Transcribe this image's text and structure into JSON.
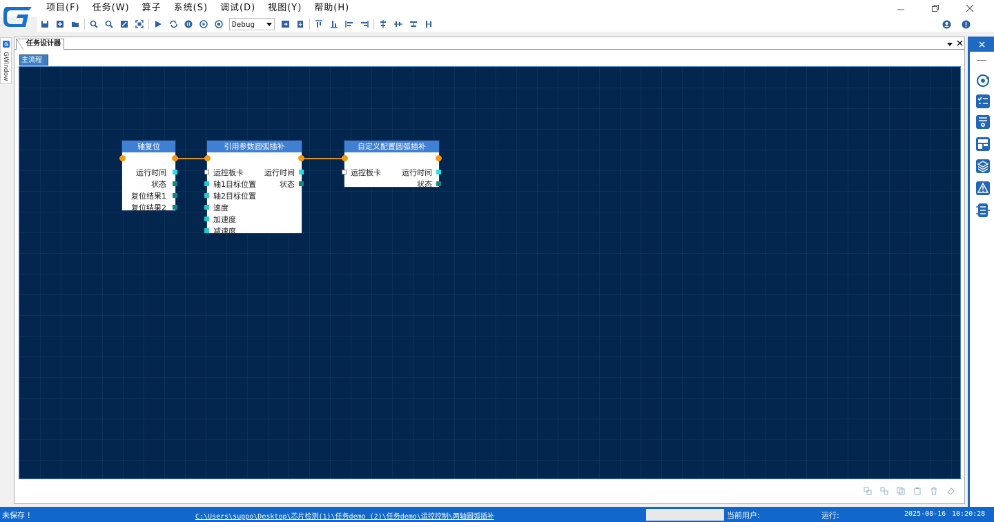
{
  "menu": [
    "项目(F)",
    "任务(W)",
    "算子",
    "系统(S)",
    "调试(D)",
    "视图(Y)",
    "帮助(H)"
  ],
  "toolbar": {
    "config_value": "Debug"
  },
  "left_dock": {
    "label": "GWindow"
  },
  "document": {
    "tab_label": "任务设计器",
    "subtab_label": "主流程"
  },
  "nodes": {
    "n1": {
      "title": "轴复位",
      "outputs": [
        "运行时间",
        "状态",
        "复位结果1",
        "复位结果2"
      ]
    },
    "n2": {
      "title": "引用参数圆弧插补",
      "inputs": [
        "运控板卡",
        "轴1目标位置",
        "轴2目标位置",
        "速度",
        "加速度",
        "减速度"
      ],
      "outputs": [
        "运行时间",
        "状态"
      ]
    },
    "n3": {
      "title": "自定义配置圆弧插补",
      "inputs": [
        "运控板卡"
      ],
      "outputs": [
        "运行时间",
        "状态"
      ]
    }
  },
  "status": {
    "saved": "未保存 !",
    "path": "C:\\Users\\suppo\\Desktop\\芯片检测(1)\\任务demo (2)\\任务demo\\运控控制\\两轴圆弧插补",
    "user_label": "当前用户:",
    "run_label": "运行:",
    "date": "2025-08-16",
    "time": "10:20:28"
  },
  "colors": {
    "canvas": "#03264f",
    "node_header": "#3f7fd4",
    "wire": "#e19120",
    "accent": "#1267cd"
  }
}
